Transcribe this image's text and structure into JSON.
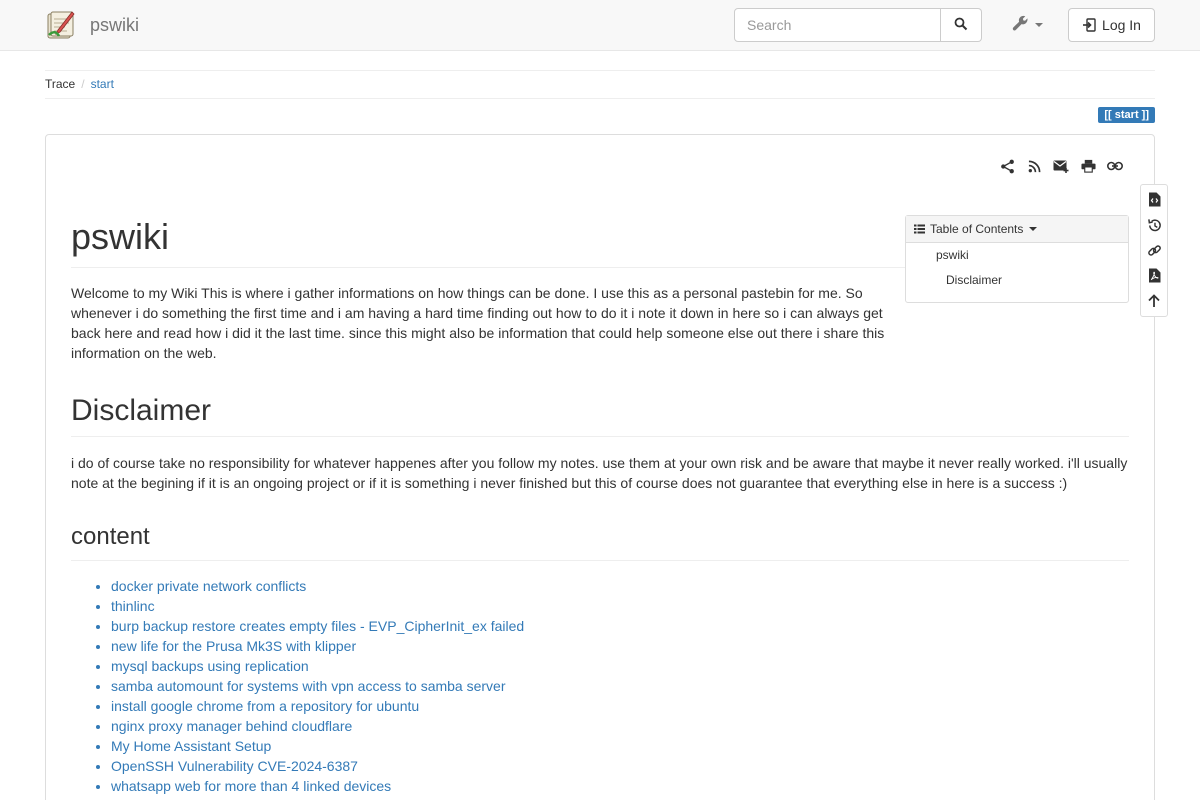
{
  "navbar": {
    "brand": "pswiki",
    "search_placeholder": "Search",
    "login_label": "Log In"
  },
  "breadcrumb": {
    "label": "Trace",
    "items": [
      "start"
    ]
  },
  "page_id": "[[ start ]]",
  "toc": {
    "title": "Table of Contents",
    "items": [
      "pswiki",
      "Disclaimer"
    ]
  },
  "article": {
    "title": "pswiki",
    "intro": "Welcome to my Wiki This is where i gather informations on how things can be done. I use this as a personal pastebin for me. So whenever i do something the first time and i am having a hard time finding out how to do it i note it down in here so i can always get back here and read how i did it the last time. since this might also be information that could help someone else out there i share this information on the web.",
    "disclaimer_heading": "Disclaimer",
    "disclaimer_text": "i do of course take no responsibility for whatever happenes after you follow my notes. use them at your own risk and be aware that maybe it never really worked. i'll usually note at the begining if it is an ongoing project or if it is something i never finished but this of course does not guarantee that everything else in here is a success :)",
    "content_heading": "content",
    "links": [
      "docker private network conflicts",
      "thinlinc",
      "burp backup restore creates empty files - EVP_CipherInit_ex failed",
      "new life for the Prusa Mk3S with klipper",
      "mysql backups using replication",
      "samba automount for systems with vpn access to samba server",
      "install google chrome from a repository for ubuntu",
      "nginx proxy manager behind cloudflare",
      "My Home Assistant Setup",
      "OpenSSH Vulnerability CVE-2024-6387",
      "whatsapp web for more than 4 linked devices"
    ]
  },
  "icons": {
    "page_tools": [
      "share-icon",
      "rss-icon",
      "email-icon",
      "print-icon",
      "link-icon"
    ],
    "side_tools": [
      "show-source-icon",
      "revisions-icon",
      "backlinks-icon",
      "export-pdf-icon",
      "back-to-top-icon"
    ]
  },
  "colors": {
    "link": "#337ab7",
    "navbar_bg": "#f8f8f8"
  }
}
